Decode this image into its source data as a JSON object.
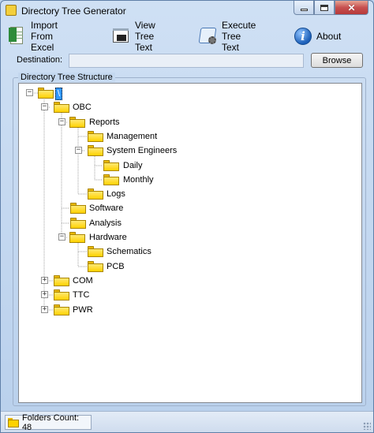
{
  "window": {
    "title": "Directory Tree Generator",
    "close_symbol": "✕"
  },
  "toolbar": {
    "import_label": "Import From Excel",
    "view_label": "View Tree Text",
    "execute_label": "Execute Tree Text",
    "about_label": "About"
  },
  "destination": {
    "label": "Destination:",
    "value": "",
    "browse_label": "Browse"
  },
  "tree": {
    "group_title": "Directory Tree Structure",
    "root": {
      "label": "\\",
      "selected": true
    },
    "nodes": [
      {
        "label": "OBC",
        "expander": "−"
      },
      {
        "label": "Reports",
        "expander": "−"
      },
      {
        "label": "Management"
      },
      {
        "label": "System Engineers",
        "expander": "−"
      },
      {
        "label": "Daily"
      },
      {
        "label": "Monthly"
      },
      {
        "label": "Logs"
      },
      {
        "label": "Software"
      },
      {
        "label": "Analysis"
      },
      {
        "label": "Hardware",
        "expander": "−"
      },
      {
        "label": "Schematics"
      },
      {
        "label": "PCB"
      },
      {
        "label": "COM",
        "expander": "+"
      },
      {
        "label": "TTC",
        "expander": "+"
      },
      {
        "label": "PWR",
        "expander": "+"
      }
    ]
  },
  "status": {
    "text": "Folders Count: 48"
  },
  "colors": {
    "folder": "#ffd200",
    "selection": "#3399ff"
  }
}
